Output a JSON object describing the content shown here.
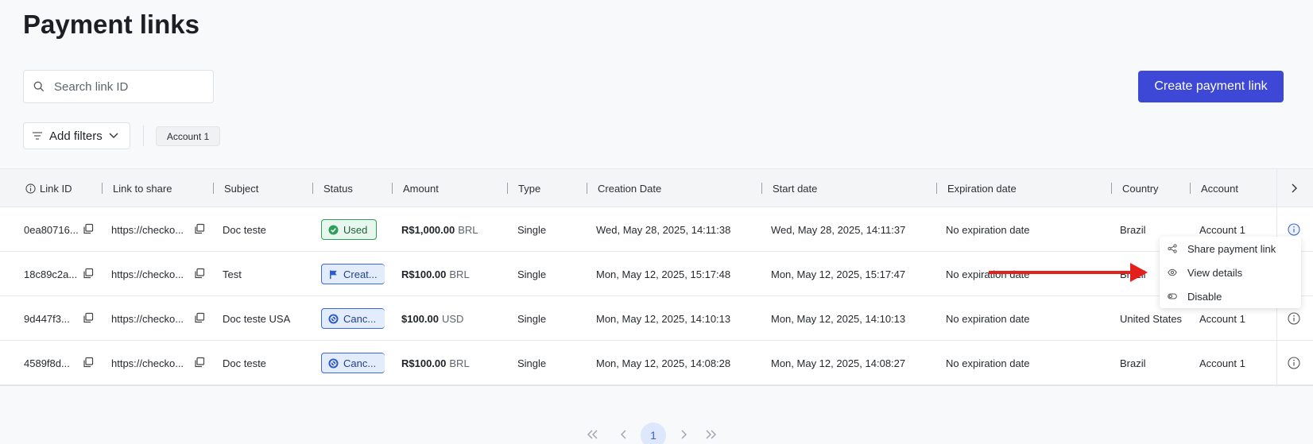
{
  "page": {
    "title": "Payment links"
  },
  "search": {
    "placeholder": "Search link ID"
  },
  "actions": {
    "create_label": "Create payment link"
  },
  "filters": {
    "add_label": "Add filters",
    "chip_label": "Account 1"
  },
  "table": {
    "columns": [
      "Link ID",
      "Link to share",
      "Subject",
      "Status",
      "Amount",
      "Type",
      "Creation Date",
      "Start date",
      "Expiration date",
      "Country",
      "Account"
    ],
    "rows": [
      {
        "link_id": "0ea80716...",
        "link": "https://checko...",
        "subject": "Doc teste",
        "status": "Used",
        "amount": "R$1,000.00",
        "currency": "BRL",
        "type": "Single",
        "created": "Wed, May 28, 2025, 14:11:38",
        "start": "Wed, May 28, 2025, 14:11:37",
        "expiration": "No expiration date",
        "country": "Brazil",
        "account": "Account 1"
      },
      {
        "link_id": "18c89c2a...",
        "link": "https://checko...",
        "subject": "Test",
        "status": "Creat...",
        "amount": "R$100.00",
        "currency": "BRL",
        "type": "Single",
        "created": "Mon, May 12, 2025, 15:17:48",
        "start": "Mon, May 12, 2025, 15:17:47",
        "expiration": "No expiration date",
        "country": "Brazil",
        "account": ""
      },
      {
        "link_id": "9d447f3...",
        "link": "https://checko...",
        "subject": "Doc teste USA",
        "status": "Canc...",
        "amount": "$100.00",
        "currency": "USD",
        "type": "Single",
        "created": "Mon, May 12, 2025, 14:10:13",
        "start": "Mon, May 12, 2025, 14:10:13",
        "expiration": "No expiration date",
        "country": "United States",
        "account": "Account 1"
      },
      {
        "link_id": "4589f8d...",
        "link": "https://checko...",
        "subject": "Doc teste",
        "status": "Canc...",
        "amount": "R$100.00",
        "currency": "BRL",
        "type": "Single",
        "created": "Mon, May 12, 2025, 14:08:28",
        "start": "Mon, May 12, 2025, 14:08:27",
        "expiration": "No expiration date",
        "country": "Brazil",
        "account": "Account 1"
      }
    ]
  },
  "context_menu": {
    "items": [
      "Share payment link",
      "View details",
      "Disable"
    ]
  },
  "pagination": {
    "current_page": "1"
  },
  "colors": {
    "primary": "#3d48d6",
    "used_status": "#2f9e5a",
    "info_status": "#3d68d8",
    "annotation_arrow": "#e3201b"
  }
}
